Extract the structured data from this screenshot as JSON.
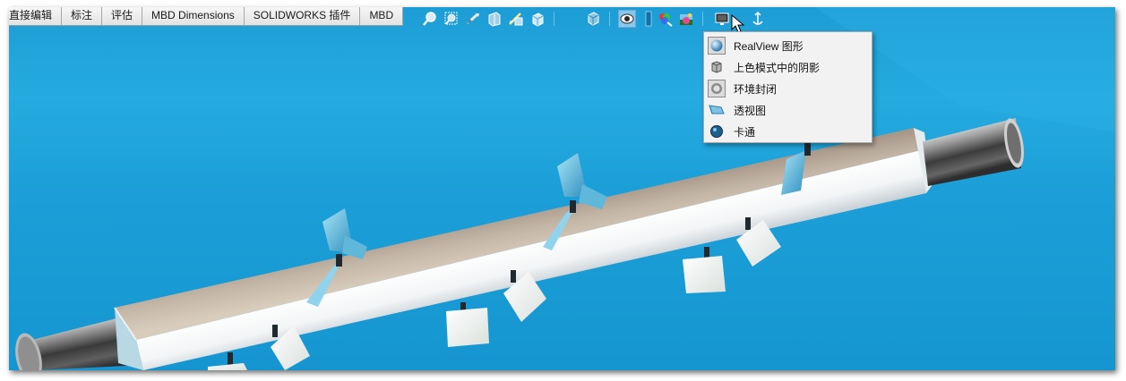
{
  "command_tabs": [
    {
      "label": "直接编辑"
    },
    {
      "label": "标注"
    },
    {
      "label": "评估"
    },
    {
      "label": "MBD Dimensions"
    },
    {
      "label": "SOLIDWORKS 插件"
    },
    {
      "label": "MBD"
    }
  ],
  "heads_up_toolbar": [
    {
      "icon": "zoom-to-fit-icon"
    },
    {
      "icon": "zoom-to-area-icon"
    },
    {
      "icon": "previous-view-icon"
    },
    {
      "icon": "section-view-icon"
    },
    {
      "icon": "dynamic-annotation-views-icon"
    },
    {
      "icon": "view-orientation-icon"
    },
    {
      "icon": "display-style-icon"
    },
    {
      "icon": "hide-show-items-icon",
      "state": "pressed"
    },
    {
      "icon": "edit-appearance-icon"
    },
    {
      "icon": "apply-scene-icon"
    },
    {
      "icon": "view-settings-icon",
      "state": "menu-open"
    },
    {
      "icon": "rotate-view-icon"
    }
  ],
  "display_menu": {
    "items": [
      {
        "label": "RealView 图形",
        "icon": "realview-graphics-icon",
        "checked": true
      },
      {
        "label": "上色模式中的阴影",
        "icon": "shadows-in-shaded-mode-icon",
        "checked": false
      },
      {
        "label": "环境封闭",
        "icon": "ambient-occlusion-icon",
        "checked": true
      },
      {
        "label": "透视图",
        "icon": "perspective-icon",
        "checked": false
      },
      {
        "label": "卡通",
        "icon": "cartoon-icon",
        "checked": false
      }
    ]
  },
  "colors": {
    "viewport_background": "#1e9fd6",
    "bar_top": "#c2b4a4",
    "bar_side": "#f6f8f8",
    "paddle": "#f2f4f2",
    "menu_background": "#f2f2f2"
  }
}
